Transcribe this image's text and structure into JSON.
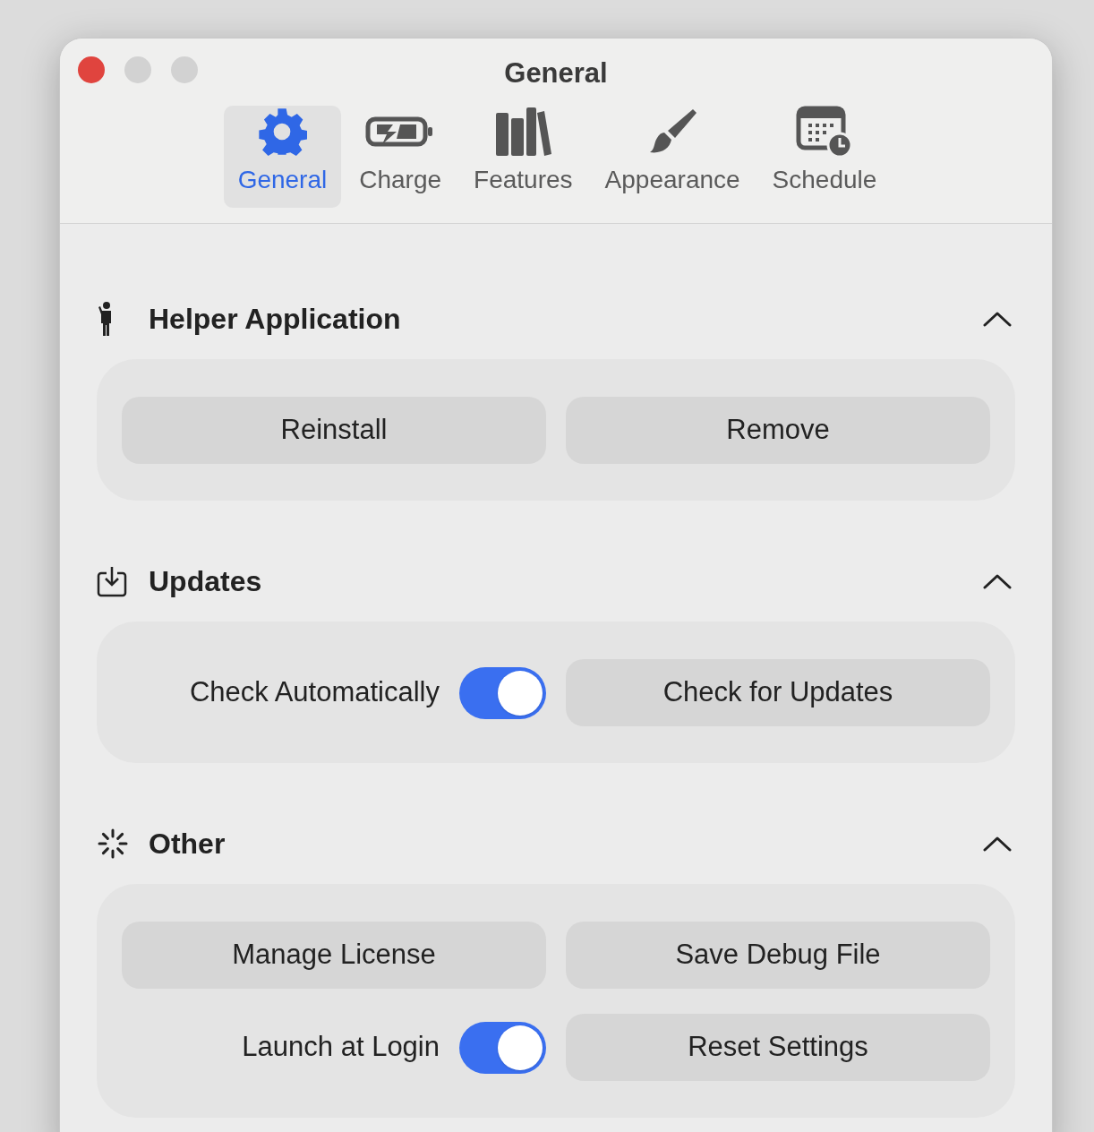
{
  "window": {
    "title": "General"
  },
  "tabs": [
    {
      "label": "General",
      "selected": true
    },
    {
      "label": "Charge",
      "selected": false
    },
    {
      "label": "Features",
      "selected": false
    },
    {
      "label": "Appearance",
      "selected": false
    },
    {
      "label": "Schedule",
      "selected": false
    }
  ],
  "sections": [
    {
      "title": "Helper Application",
      "expanded": true,
      "rows": [
        [
          {
            "kind": "button",
            "label": "Reinstall"
          },
          {
            "kind": "button",
            "label": "Remove"
          }
        ]
      ]
    },
    {
      "title": "Updates",
      "expanded": true,
      "rows": [
        [
          {
            "kind": "toggle",
            "label": "Check Automatically",
            "on": true
          },
          {
            "kind": "button",
            "label": "Check for Updates"
          }
        ]
      ]
    },
    {
      "title": "Other",
      "expanded": true,
      "rows": [
        [
          {
            "kind": "button",
            "label": "Manage License"
          },
          {
            "kind": "button",
            "label": "Save Debug File"
          }
        ],
        [
          {
            "kind": "toggle",
            "label": "Launch at Login",
            "on": true
          },
          {
            "kind": "button",
            "label": "Reset Settings"
          }
        ]
      ]
    }
  ]
}
